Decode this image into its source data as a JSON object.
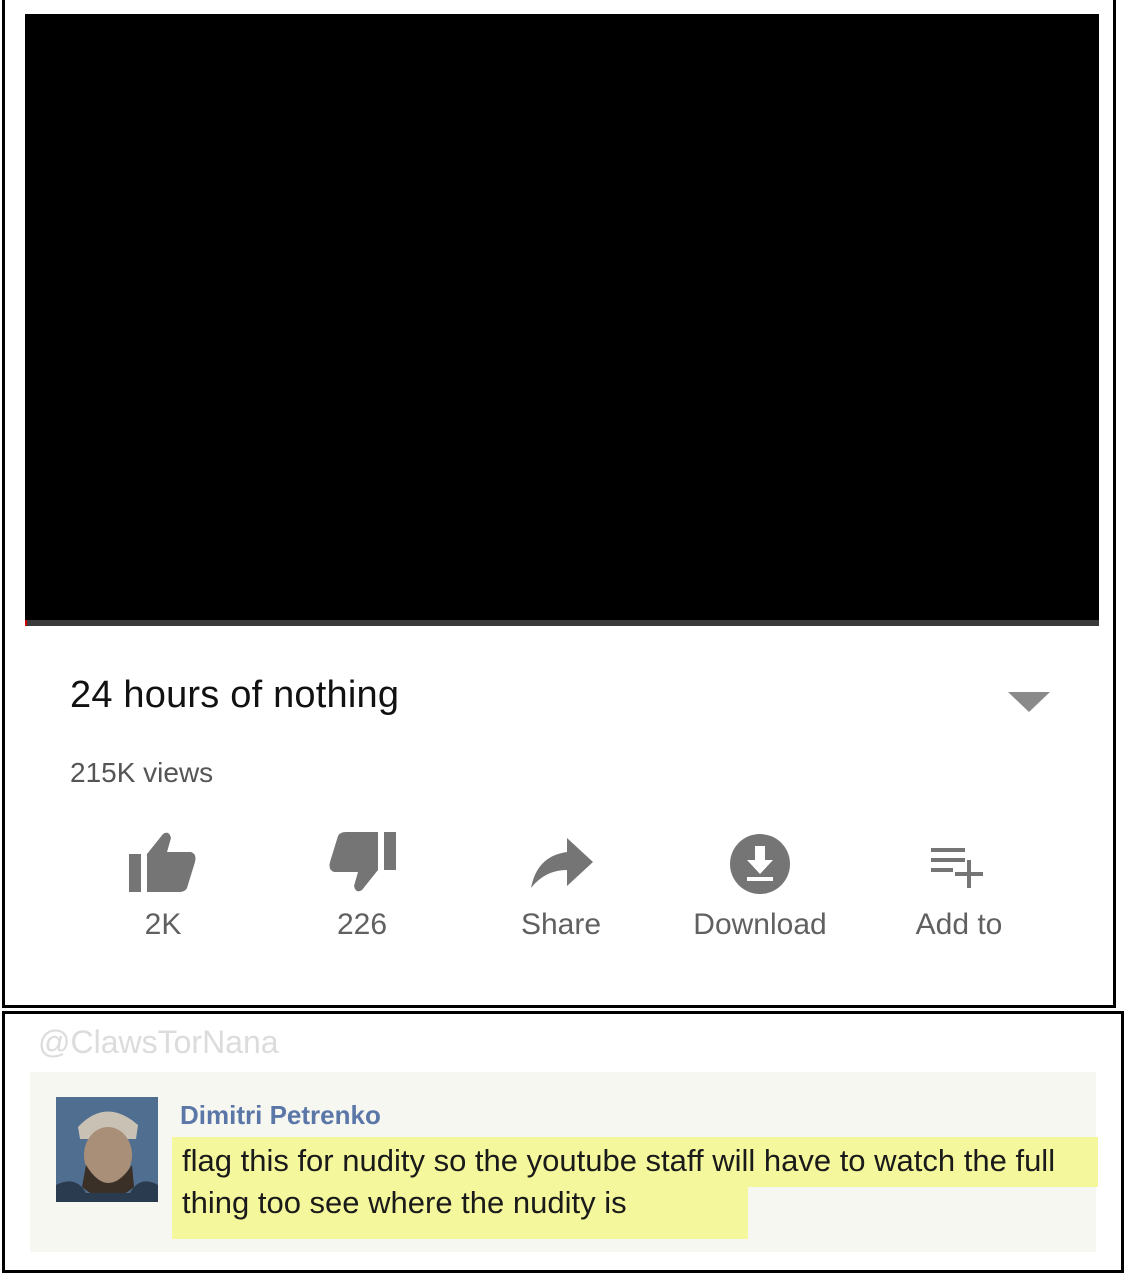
{
  "video": {
    "title": "24 hours of nothing",
    "views": "215K views",
    "progress_fraction": 0.002
  },
  "actions": [
    {
      "label": "2K",
      "icon": "thumbs-up-icon"
    },
    {
      "label": "226",
      "icon": "thumbs-down-icon"
    },
    {
      "label": "Share",
      "icon": "share-arrow-icon"
    },
    {
      "label": "Download",
      "icon": "download-icon"
    },
    {
      "label": "Add to",
      "icon": "playlist-add-icon"
    }
  ],
  "watermark": "@ClawsTorNana",
  "comment": {
    "author": "Dimitri Petrenko",
    "text": "flag this for nudity so the youtube staff will have to watch the full thing too see where the nudity is",
    "highlight_color": "#f4f79c"
  },
  "colors": {
    "icon_gray": "#757575",
    "progress_red": "#cc0000",
    "author_blue": "#5b77a8"
  }
}
